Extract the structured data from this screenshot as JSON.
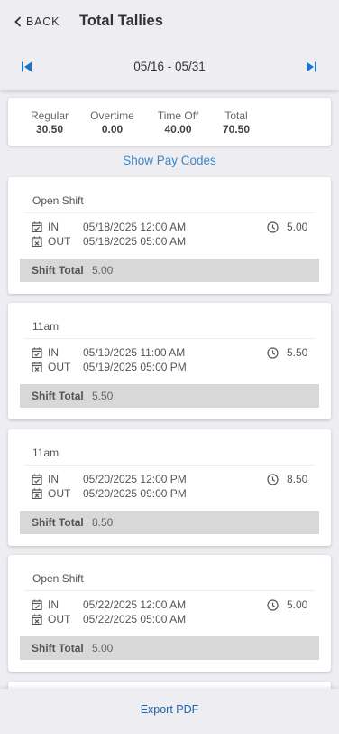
{
  "header": {
    "back_label": "BACK",
    "title": "Total Tallies",
    "date_range": "05/16 - 05/31"
  },
  "totals": [
    {
      "label": "Regular",
      "value": "30.50"
    },
    {
      "label": "Overtime",
      "value": "0.00"
    },
    {
      "label": "Time Off",
      "value": "40.00"
    },
    {
      "label": "Total",
      "value": "70.50"
    }
  ],
  "show_pay_codes": "Show Pay Codes",
  "shifts": [
    {
      "name": "Open Shift",
      "in_label": "IN",
      "in_time": "05/18/2025 12:00 AM",
      "out_label": "OUT",
      "out_time": "05/18/2025 05:00 AM",
      "hours": "5.00",
      "total_label": "Shift Total",
      "total_value": "5.00"
    },
    {
      "name": "11am",
      "in_label": "IN",
      "in_time": "05/19/2025 11:00 AM",
      "out_label": "OUT",
      "out_time": "05/19/2025 05:00 PM",
      "hours": "5.50",
      "total_label": "Shift Total",
      "total_value": "5.50"
    },
    {
      "name": "11am",
      "in_label": "IN",
      "in_time": "05/20/2025 12:00 PM",
      "out_label": "OUT",
      "out_time": "05/20/2025 09:00 PM",
      "hours": "8.50",
      "total_label": "Shift Total",
      "total_value": "8.50"
    },
    {
      "name": "Open Shift",
      "in_label": "IN",
      "in_time": "05/22/2025 12:00 AM",
      "out_label": "OUT",
      "out_time": "05/22/2025 05:00 AM",
      "hours": "5.00",
      "total_label": "Shift Total",
      "total_value": "5.00"
    }
  ],
  "footer": {
    "export_label": "Export PDF"
  },
  "colors": {
    "accent": "#3b86c6",
    "nav_blue": "#1f74c8",
    "export_blue": "#1e63b0",
    "background": "#eeeef2"
  },
  "icons": {
    "back": "chevron-left-icon",
    "prev": "skip-previous-icon",
    "next": "skip-next-icon",
    "in": "calendar-in-icon",
    "out": "calendar-out-icon",
    "hours": "clock-icon"
  }
}
